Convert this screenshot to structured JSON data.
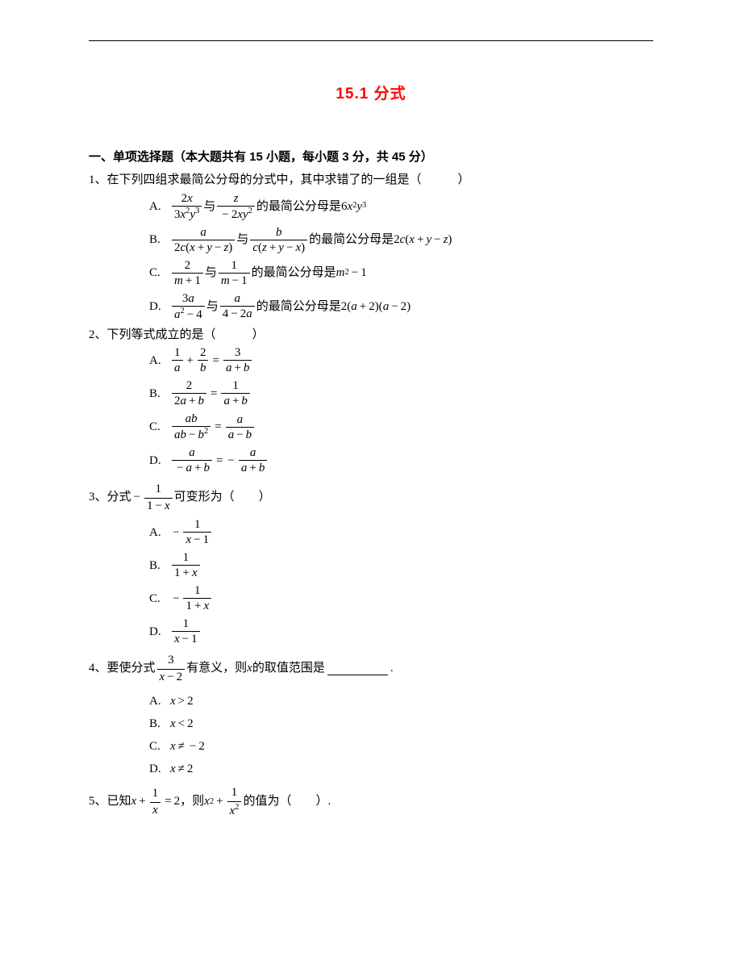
{
  "title": "15.1 分式",
  "section1": {
    "heading": "一、单项选择题（本大题共有 15 小题，每小题 3 分，共 45 分）",
    "q1": {
      "stem_pre": "1、在下列四组求最简公分母的分式中，其中求错了的一组是（",
      "stem_post": "）",
      "A_tail": "的最简公分母是",
      "B_mid": "与",
      "B_tail": "的最简公分母是",
      "C_mid": "与",
      "C_tail": "的最简公分母是",
      "D_mid": "与",
      "D_tail": "的最简公分母是",
      "A_lbl": "A.",
      "B_lbl": "B.",
      "C_lbl": "C.",
      "D_lbl": "D."
    },
    "q2": {
      "stem": "2、下列等式成立的是（　　　）",
      "A_lbl": "A.",
      "B_lbl": "B.",
      "C_lbl": "C.",
      "D_lbl": "D."
    },
    "q3": {
      "stem_pre": "3、分式",
      "stem_post": "可变形为（　　）",
      "A_lbl": "A.",
      "B_lbl": "B.",
      "C_lbl": "C.",
      "D_lbl": "D."
    },
    "q4": {
      "stem_pre": "4、要使分式",
      "stem_mid": "有意义，则",
      "stem_post": "的取值范围是",
      "stem_end": ".",
      "A_lbl": "A.",
      "B_lbl": "B.",
      "C_lbl": "C.",
      "D_lbl": "D."
    },
    "q5": {
      "stem_pre": "5、已知",
      "stem_mid": "，则",
      "stem_post": "的值为（　　）."
    }
  }
}
